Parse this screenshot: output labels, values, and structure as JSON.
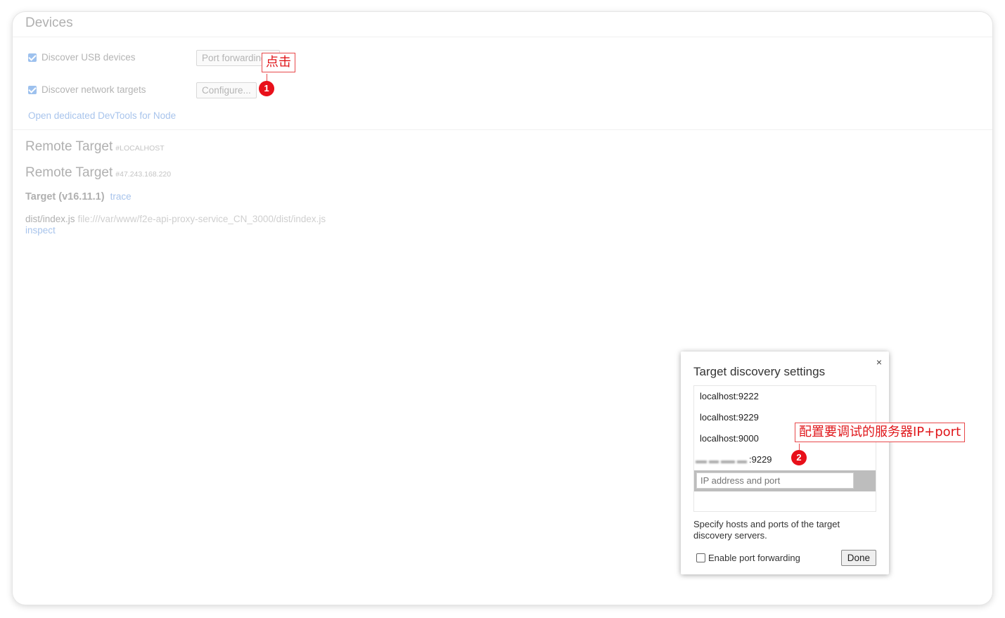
{
  "devices": {
    "title": "Devices",
    "discover_usb_label": "Discover USB devices",
    "discover_usb_checked": true,
    "port_forwarding_button": "Port forwarding...",
    "discover_network_label": "Discover network targets",
    "discover_network_checked": true,
    "configure_button": "Configure...",
    "open_node_link": "Open dedicated DevTools for Node"
  },
  "remote_targets": [
    {
      "title": "Remote Target",
      "host": "#LOCALHOST"
    },
    {
      "title": "Remote Target",
      "host": "#47.243.168.220"
    }
  ],
  "target": {
    "name": "Target (v16.11.1)",
    "trace_link": "trace",
    "file": "dist/index.js",
    "path": "file:///var/www/f2e-api-proxy-service_CN_3000/dist/index.js",
    "inspect_link": "inspect"
  },
  "annotations": {
    "click_label": "点击",
    "click_number": "1",
    "config_label": "配置要调试的服务器IP+port",
    "config_number": "2"
  },
  "dialog": {
    "title": "Target discovery settings",
    "close_icon": "×",
    "entries": [
      "localhost:9222",
      "localhost:9229",
      "localhost:9000"
    ],
    "blurred_entry_port": ":9229",
    "input_placeholder": "IP address and port",
    "help_text": "Specify hosts and ports of the target discovery servers.",
    "enable_port_forwarding_label": "Enable port forwarding",
    "enable_port_forwarding_checked": false,
    "done_button": "Done"
  },
  "colors": {
    "annotation_red": "#e8101a",
    "link_blue_faded": "#a8c4ec"
  }
}
